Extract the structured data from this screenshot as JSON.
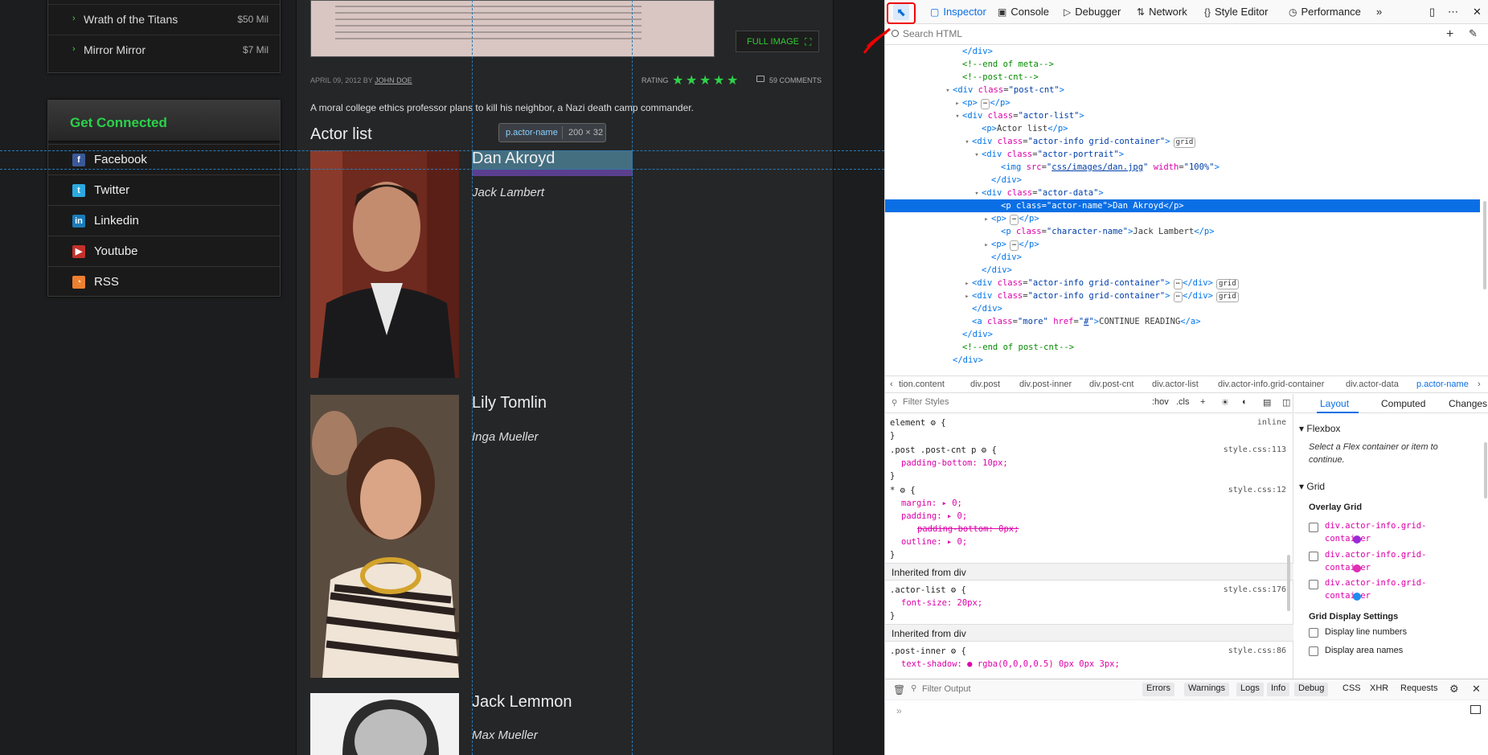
{
  "page": {
    "movies": [
      {
        "name": "Wrath of the Titans",
        "value": "$50 Mil"
      },
      {
        "name": "Mirror Mirror",
        "value": "$7 Mil"
      }
    ],
    "connect": {
      "title": "Get Connected",
      "items": [
        {
          "label": "Facebook",
          "icon": "facebook-icon",
          "color": "#3b5998",
          "glyph": "f"
        },
        {
          "label": "Twitter",
          "icon": "twitter-icon",
          "color": "#2ba9e1",
          "glyph": "t"
        },
        {
          "label": "Linkedin",
          "icon": "linkedin-icon",
          "color": "#1a7bb9",
          "glyph": "in"
        },
        {
          "label": "Youtube",
          "icon": "youtube-icon",
          "color": "#c4302b",
          "glyph": "▶"
        },
        {
          "label": "RSS",
          "icon": "rss-icon",
          "color": "#ee802f",
          "glyph": "◔"
        }
      ]
    },
    "full_image_label": "FULL IMAGE",
    "meta": {
      "date_prefix": "APRIL 09, 2012 BY",
      "author": "JOHN DOE",
      "rating_label": "RATING",
      "stars": 5,
      "comments": "59 COMMENTS"
    },
    "synopsis": "A moral college ethics professor plans to kill his neighbor, a Nazi death camp commander.",
    "actor_list_title": "Actor list",
    "actors": [
      {
        "name": "Dan Akroyd",
        "character": "Jack Lambert"
      },
      {
        "name": "Lily Tomlin",
        "character": "Inga Mueller"
      },
      {
        "name": "Jack Lemmon",
        "character": "Max Mueller"
      }
    ],
    "tooltip": {
      "selector": "p.actor-name",
      "dims": "200 × 32"
    },
    "accent": "#2fd14a"
  },
  "devtools": {
    "tabs": [
      "Inspector",
      "Console",
      "Debugger",
      "Network",
      "Style Editor",
      "Performance"
    ],
    "search_placeholder": "Search HTML",
    "markup": [
      {
        "indent": 7,
        "tw": "",
        "html": "<span class='tag'>&lt;/div&gt;</span>"
      },
      {
        "indent": 7,
        "tw": "",
        "html": "<span class='cm'>&lt;!--end of meta--&gt;</span>"
      },
      {
        "indent": 7,
        "tw": "",
        "html": "<span class='cm'>&lt;!--post-cnt--&gt;</span>"
      },
      {
        "indent": 6,
        "tw": "▾",
        "html": "<span class='tag'>&lt;div</span> <span class='attr'>class</span>=<span class='val'>\"post-cnt\"</span><span class='tag'>&gt;</span>"
      },
      {
        "indent": 7,
        "tw": "▸",
        "html": "<span class='tag'>&lt;p&gt;</span><span class='badge'>⋯</span><span class='tag'>&lt;/p&gt;</span>"
      },
      {
        "indent": 7,
        "tw": "▾",
        "html": "<span class='tag'>&lt;div</span> <span class='attr'>class</span>=<span class='val'>\"actor-list\"</span><span class='tag'>&gt;</span>"
      },
      {
        "indent": 9,
        "tw": "",
        "html": "<span class='tag'>&lt;p&gt;</span>Actor list<span class='tag'>&lt;/p&gt;</span>"
      },
      {
        "indent": 8,
        "tw": "▾",
        "html": "<span class='tag'>&lt;div</span> <span class='attr'>class</span>=<span class='val'>\"actor-info grid-container\"</span><span class='tag'>&gt;</span><span class='badge'>grid</span>"
      },
      {
        "indent": 9,
        "tw": "▾",
        "html": "<span class='tag'>&lt;div</span> <span class='attr'>class</span>=<span class='val'>\"actor-portrait\"</span><span class='tag'>&gt;</span>"
      },
      {
        "indent": 11,
        "tw": "",
        "html": "<span class='tag'>&lt;img</span> <span class='attr'>src</span>=<span class='val'>\"<u>css/images/dan.jpg</u>\"</span> <span class='attr'>width</span>=<span class='val'>\"100%\"</span><span class='tag'>&gt;</span>"
      },
      {
        "indent": 10,
        "tw": "",
        "html": "<span class='tag'>&lt;/div&gt;</span>"
      },
      {
        "indent": 9,
        "tw": "▾",
        "html": "<span class='tag'>&lt;div</span> <span class='attr'>class</span>=<span class='val'>\"actor-data\"</span><span class='tag'>&gt;</span>"
      },
      {
        "indent": 11,
        "tw": "",
        "sel": true,
        "html": "<span class='tag'>&lt;p</span> <span class='attr'>class</span>=<span class='val'>\"actor-name\"</span><span class='tag'>&gt;</span>Dan Akroyd<span class='tag'>&lt;/p&gt;</span>"
      },
      {
        "indent": 10,
        "tw": "▸",
        "html": "<span class='tag'>&lt;p&gt;</span><span class='badge'>⋯</span><span class='tag'>&lt;/p&gt;</span>"
      },
      {
        "indent": 11,
        "tw": "",
        "html": "<span class='tag'>&lt;p</span> <span class='attr'>class</span>=<span class='val'>\"character-name\"</span><span class='tag'>&gt;</span>Jack Lambert<span class='tag'>&lt;/p&gt;</span>"
      },
      {
        "indent": 10,
        "tw": "▸",
        "html": "<span class='tag'>&lt;p&gt;</span><span class='badge'>⋯</span><span class='tag'>&lt;/p&gt;</span>"
      },
      {
        "indent": 10,
        "tw": "",
        "html": "<span class='tag'>&lt;/div&gt;</span>"
      },
      {
        "indent": 9,
        "tw": "",
        "html": "<span class='tag'>&lt;/div&gt;</span>"
      },
      {
        "indent": 8,
        "tw": "▸",
        "html": "<span class='tag'>&lt;div</span> <span class='attr'>class</span>=<span class='val'>\"actor-info grid-container\"</span><span class='tag'>&gt;</span><span class='badge'>⋯</span><span class='tag'>&lt;/div&gt;</span><span class='badge'>grid</span>"
      },
      {
        "indent": 8,
        "tw": "▸",
        "html": "<span class='tag'>&lt;div</span> <span class='attr'>class</span>=<span class='val'>\"actor-info grid-container\"</span><span class='tag'>&gt;</span><span class='badge'>⋯</span><span class='tag'>&lt;/div&gt;</span><span class='badge'>grid</span>"
      },
      {
        "indent": 8,
        "tw": "",
        "html": "<span class='tag'>&lt;/div&gt;</span>"
      },
      {
        "indent": 8,
        "tw": "",
        "html": "<span class='tag'>&lt;a</span> <span class='attr'>class</span>=<span class='val'>\"more\"</span> <span class='attr'>href</span>=<span class='val'>\"<u>#</u>\"</span><span class='tag'>&gt;</span>CONTINUE READING<span class='tag'>&lt;/a&gt;</span>"
      },
      {
        "indent": 7,
        "tw": "",
        "html": "<span class='tag'>&lt;/div&gt;</span>"
      },
      {
        "indent": 7,
        "tw": "",
        "html": "<span class='cm'>&lt;!--end of post-cnt--&gt;</span>"
      },
      {
        "indent": 6,
        "tw": "",
        "html": "<span class='tag'>&lt;/div&gt;</span>"
      }
    ],
    "breadcrumbs": [
      "tion.content",
      "div.post",
      "div.post-inner",
      "div.post-cnt",
      "div.actor-list",
      "div.actor-info.grid-container",
      "div.actor-data",
      "p.actor-name"
    ],
    "rules_toolbar": {
      "filter_placeholder": "Filter Styles",
      "hov": ":hov",
      "cls": ".cls"
    },
    "rules": {
      "element_selector": "element",
      "element_src": "inline",
      "r1_selector": ".post .post-cnt p",
      "r1_src": "style.css:113",
      "r1_decl": "padding-bottom: 10px;",
      "r2_selector": "*",
      "r2_src": "style.css:12",
      "r2_margin": "margin: ▸ 0;",
      "r2_padding": "padding: ▸ 0;",
      "r2_overridden": "padding-bottom: 0px;",
      "r2_outline": "outline: ▸ 0;",
      "inherited1": "Inherited from div",
      "r3_selector": ".actor-list",
      "r3_src": "style.css:176",
      "r3_decl": "font-size: 20px;",
      "inherited2": "Inherited from div",
      "r4_selector": ".post-inner",
      "r4_src": "style.css:86",
      "r4_decl": "text-shadow: ● rgba(0,0,0,0.5) 0px 0px 3px;"
    },
    "layout_tabs": [
      "Layout",
      "Computed",
      "Changes"
    ],
    "flexbox": {
      "title": "Flexbox",
      "note": "Select a Flex container or item to continue."
    },
    "grid": {
      "title": "Grid",
      "overlay_title": "Overlay Grid",
      "items": [
        {
          "name": "div.actor-info.grid-container",
          "color": "#9a2bd8"
        },
        {
          "name": "div.actor-info.grid-container",
          "color": "#e02fb2"
        },
        {
          "name": "div.actor-info.grid-container",
          "color": "#1f8cf0"
        }
      ],
      "display_title": "Grid Display Settings",
      "opt1": "Display line numbers",
      "opt2": "Display area names"
    },
    "console": {
      "filter_placeholder": "Filter Output",
      "levels": [
        "Errors",
        "Warnings",
        "Logs",
        "Info",
        "Debug"
      ],
      "types": [
        "CSS",
        "XHR",
        "Requests"
      ],
      "prompt": "»"
    }
  }
}
